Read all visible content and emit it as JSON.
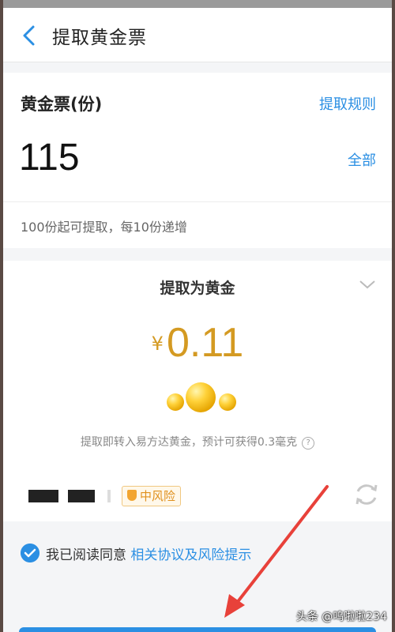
{
  "header": {
    "title": "提取黄金票"
  },
  "ticket": {
    "label": "黄金票(份)",
    "rules_link": "提取规则",
    "amount": "115",
    "all_button": "全部",
    "hint": "100份起可提取，每10份递增"
  },
  "extract": {
    "title": "提取为黄金",
    "currency": "¥",
    "value": "0.11",
    "note": "提取即转入易方达黄金，预计可获得0.3毫克",
    "help_icon": "?",
    "risk_badge": "中风险"
  },
  "agreement": {
    "prefix": "我已阅读同意",
    "link": "相关协议及风险提示"
  },
  "watermark": "头条 @呜啦啦234",
  "colors": {
    "accent": "#2b8fe3",
    "gold": "#d49a22",
    "annotation": "#e8413a"
  }
}
